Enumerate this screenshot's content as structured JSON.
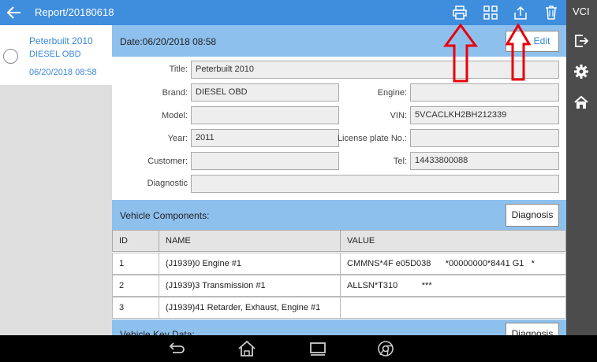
{
  "header": {
    "title": "Report/20180618",
    "vci_label": "VCI"
  },
  "list": {
    "items": [
      {
        "name": "Peterbuilt 2010",
        "subtitle": "DIESEL OBD",
        "date": "06/20/2018 08:58"
      }
    ]
  },
  "report": {
    "date_label": "Date:06/20/2018 08:58",
    "edit_label": "Edit",
    "fields": {
      "title_label": "Title:",
      "title_value": "Peterbuilt 2010",
      "brand_label": "Brand:",
      "brand_value": "DIESEL OBD",
      "engine_label": "Engine:",
      "engine_value": "",
      "model_label": "Model:",
      "model_value": "",
      "vin_label": "VIN:",
      "vin_value": "5VCACLKH2BH212339",
      "year_label": "Year:",
      "year_value": "2011",
      "plate_label": "License plate No.:",
      "plate_value": "",
      "customer_label": "Customer:",
      "customer_value": "",
      "tel_label": "Tel:",
      "tel_value": "14433800088",
      "result_label": "Diagnostic Result:",
      "result_value": ""
    }
  },
  "components": {
    "title": "Vehicle Components:",
    "button_label": "Diagnosis",
    "columns": [
      "ID",
      "NAME",
      "VALUE"
    ],
    "rows": [
      {
        "id": "1",
        "name": "(J1939)0 Engine #1",
        "value": "CMMNS*4F e05D038      *00000000*8441 G1   *"
      },
      {
        "id": "2",
        "name": "(J1939)3 Transmission #1",
        "value": "ALLSN*T310          ***"
      },
      {
        "id": "3",
        "name": "(J1939)41 Retarder, Exhaust, Engine #1",
        "value": ""
      }
    ]
  },
  "key_data": {
    "title": "Vehicle Key Data:",
    "button_label": "Diagnosis"
  },
  "colors": {
    "topbar": "#3f8ede",
    "section": "#8ec0ee",
    "accent_text": "#3a87d8",
    "arrow": "#e8000b",
    "rail": "#4c4c4c"
  },
  "icons": [
    "back-arrow-icon",
    "print-icon",
    "grid-icon",
    "share-icon",
    "trash-icon",
    "exit-icon",
    "gear-icon",
    "home-icon",
    "nav-back-icon",
    "nav-home-icon",
    "nav-recents-icon",
    "chrome-icon"
  ]
}
